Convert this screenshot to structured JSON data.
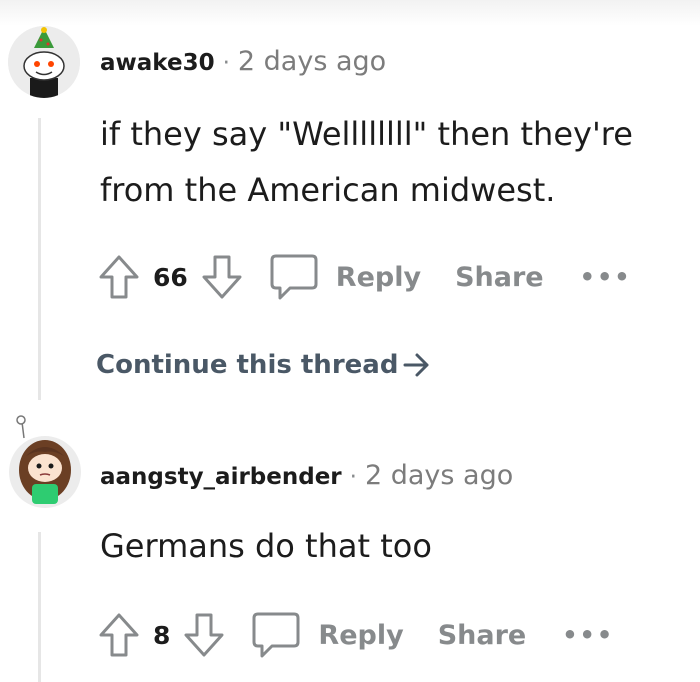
{
  "comments": [
    {
      "username": "awake30",
      "separator": "·",
      "time": "2 days ago",
      "body_lines": [
        "if they say \"Wellllllll\" then they're",
        "from the American midwest."
      ],
      "votes": "66",
      "reply_label": "Reply",
      "share_label": "Share",
      "more_label": "•••",
      "continue_label": "Continue this thread"
    },
    {
      "username": "aangsty_airbender",
      "separator": "·",
      "time": "2 days ago",
      "body_lines": [
        "Germans do that too"
      ],
      "votes": "8",
      "reply_label": "Reply",
      "share_label": "Share",
      "more_label": "•••"
    }
  ],
  "colors": {
    "text": "#1c1c1c",
    "muted": "#878a8c",
    "thread_line": "#e6e6e6",
    "continue": "#4a5866"
  },
  "icons": [
    "upvote-arrow-icon",
    "downvote-arrow-icon",
    "comment-bubble-icon",
    "right-arrow-icon"
  ]
}
